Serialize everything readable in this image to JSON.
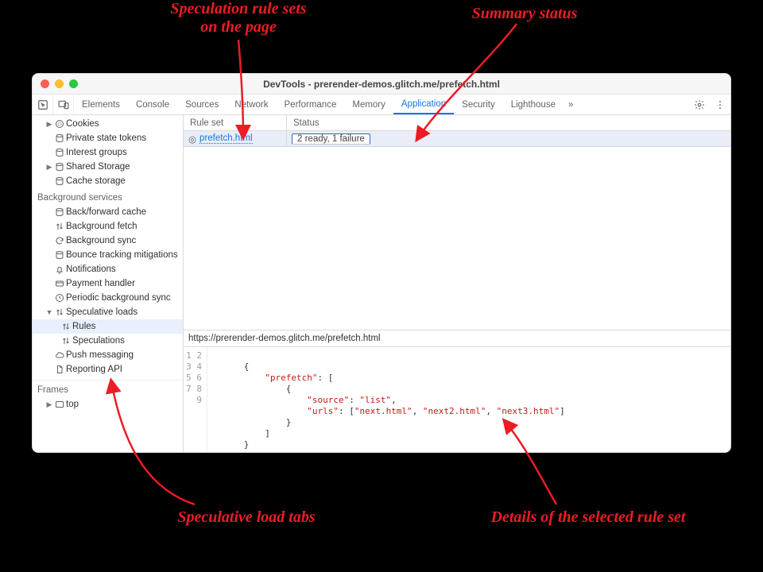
{
  "annotations": {
    "rule_sets": "Speculation rule sets\non the page",
    "summary_status": "Summary status",
    "load_tabs": "Speculative load tabs",
    "details": "Details of the selected rule set"
  },
  "window": {
    "title": "DevTools - prerender-demos.glitch.me/prefetch.html"
  },
  "tabs": {
    "elements": "Elements",
    "console": "Console",
    "sources": "Sources",
    "network": "Network",
    "performance": "Performance",
    "memory": "Memory",
    "application": "Application",
    "security": "Security",
    "lighthouse": "Lighthouse"
  },
  "sidebar": {
    "cookies": "Cookies",
    "private_state_tokens": "Private state tokens",
    "interest_groups": "Interest groups",
    "shared_storage": "Shared Storage",
    "cache_storage": "Cache storage",
    "bg_head": "Background services",
    "bf_cache": "Back/forward cache",
    "bg_fetch": "Background fetch",
    "bg_sync": "Background sync",
    "bounce": "Bounce tracking mitigations",
    "notifications": "Notifications",
    "payment": "Payment handler",
    "periodic": "Periodic background sync",
    "speculative": "Speculative loads",
    "rules": "Rules",
    "speculations": "Speculations",
    "push": "Push messaging",
    "reporting": "Reporting API",
    "frames_head": "Frames",
    "top": "top"
  },
  "table": {
    "head_ruleset": "Rule set",
    "head_status": "Status",
    "row_ruleset": "prefetch.html",
    "row_status": "2 ready, 1 failure"
  },
  "detail": {
    "url": "https://prerender-demos.glitch.me/prefetch.html",
    "code_lines": [
      "",
      "{",
      "  \"prefetch\": [",
      "    {",
      "      \"source\": \"list\",",
      "      \"urls\": [\"next.html\", \"next2.html\", \"next3.html\"]",
      "    }",
      "  ]",
      "}"
    ]
  }
}
